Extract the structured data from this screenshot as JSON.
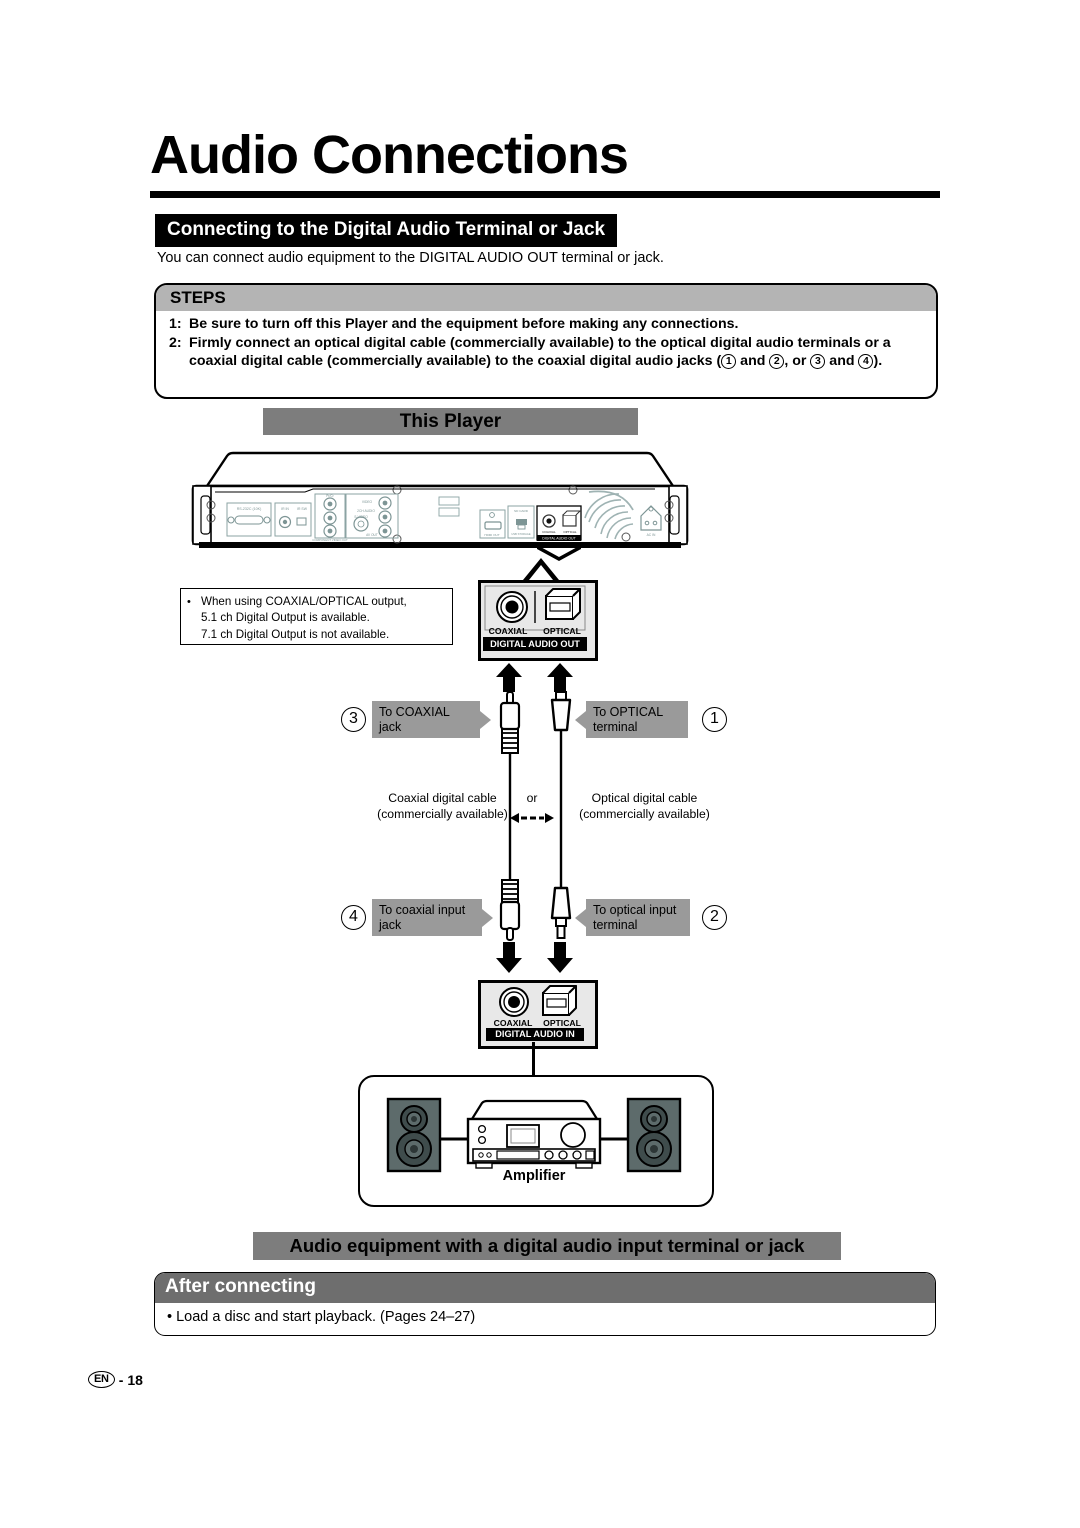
{
  "page": {
    "title": "Audio Connections",
    "footer_badge": "EN",
    "footer_sep": "-",
    "footer_page": "18"
  },
  "section": {
    "header": "Connecting to the Digital Audio Terminal or Jack",
    "intro": "You can connect audio equipment to the DIGITAL AUDIO OUT terminal or jack."
  },
  "steps": {
    "header": "STEPS",
    "items": [
      {
        "num": "1:",
        "parts": [
          {
            "t": "Be sure to turn off this Player and the equipment before making any connections."
          }
        ]
      },
      {
        "num": "2:",
        "parts": [
          {
            "t": "Firmly connect an optical digital cable (commercially available) to the optical digital audio terminals or a coaxial digital cable (commercially available) to the coaxial digital audio jacks ("
          },
          {
            "circle": "1"
          },
          {
            "t": " and "
          },
          {
            "circle": "2"
          },
          {
            "t": ", or "
          },
          {
            "circle": "3"
          },
          {
            "t": " and "
          },
          {
            "circle": "4"
          },
          {
            "t": ")."
          }
        ]
      }
    ]
  },
  "diagram": {
    "this_player_header": "This Player",
    "audio_equipment_header": "Audio equipment with a digital audio input terminal or jack",
    "note": {
      "bullet": "•",
      "lines": [
        "When using COAXIAL/OPTICAL output,",
        "5.1 ch Digital Output is available.",
        "7.1 ch Digital Output is not available."
      ]
    },
    "digital_audio_out_panel": {
      "coaxial": "COAXIAL",
      "optical": "OPTICAL",
      "title": "DIGITAL AUDIO OUT"
    },
    "digital_audio_in_panel": {
      "coaxial": "COAXIAL",
      "optical": "OPTICAL",
      "title": "DIGITAL AUDIO IN"
    },
    "callouts": {
      "to_coaxial_jack": "To COAXIAL\njack",
      "to_optical_terminal": "To OPTICAL\nterminal",
      "to_coaxial_input_jack": "To coaxial input\njack",
      "to_optical_input_terminal": "To optical input\nterminal"
    },
    "callout_numbers": {
      "coaxial_out": "3",
      "optical_out": "1",
      "coaxial_in": "4",
      "optical_in": "2"
    },
    "cables": {
      "coaxial": "Coaxial digital cable\n(commercially available)",
      "optical": "Optical digital cable\n(commercially available)",
      "or": "or"
    },
    "amplifier_label": "Amplifier",
    "rear_panel_ports": [
      "RS-232C  (10K)",
      "IR IN",
      "IR SW",
      "Pr/Cr",
      "Pb/Cb",
      "Y",
      "COMPONENT VIDEO OUT",
      "VIDEO",
      "2CH AUDIO",
      "S-VIDEO",
      "L",
      "R",
      "AV OUT",
      "HDMI OUT",
      "SD CARD",
      "USB STORAGE DEVICE",
      "COAXIAL",
      "OPTICAL",
      "DIGITAL AUDIO OUT",
      "AC IN"
    ]
  },
  "after": {
    "header": "After connecting",
    "bullet": "•",
    "text": "Load a disc and start playback. (Pages 24–27)"
  },
  "colors": {
    "gray_header": "#7d7d7d",
    "steps_header": "#b4b4b4",
    "callout_gray": "#9a9a9a",
    "after_header": "#6e6e6e",
    "panel_fill": "#e8e8e8",
    "speaker_fill": "#5d6b6b"
  }
}
